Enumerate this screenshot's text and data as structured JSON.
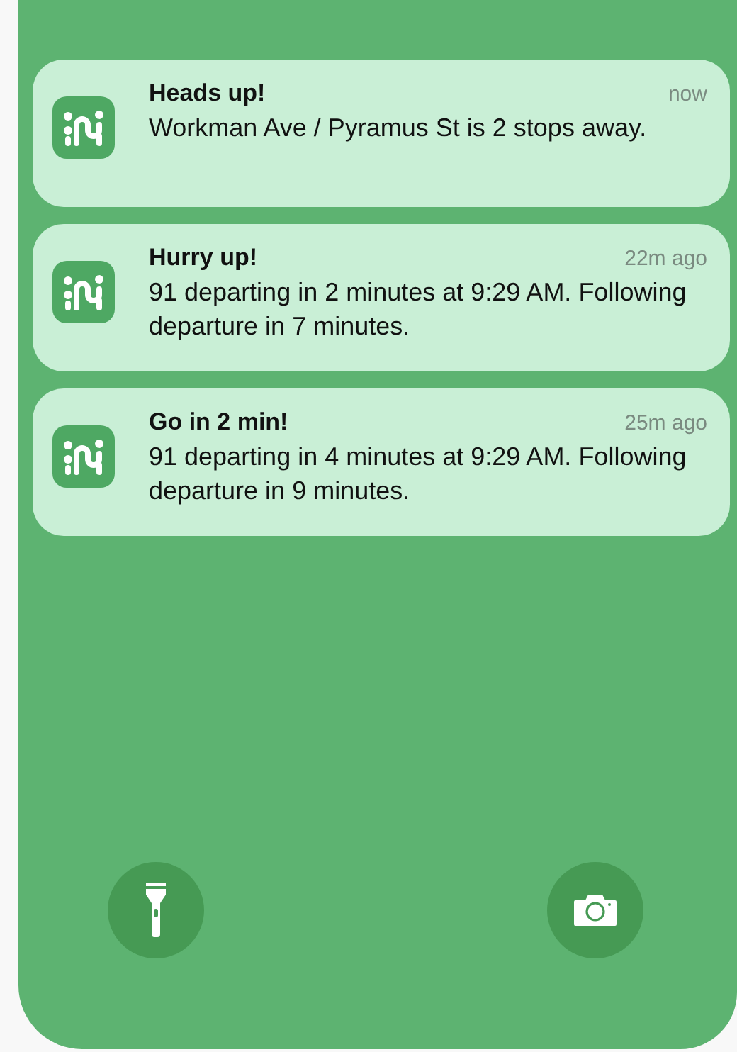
{
  "notifications": [
    {
      "title": "Heads up!",
      "time": "now",
      "body": "Workman Ave / Pyramus St is 2 stops away."
    },
    {
      "title": "Hurry up!",
      "time": "22m ago",
      "body": "91 departing in 2 minutes at 9:29 AM. Following departure in 7 minutes."
    },
    {
      "title": "Go in 2 min!",
      "time": "25m ago",
      "body": "91 departing in 4 minutes at 9:29 AM. Following departure in 9 minutes."
    }
  ],
  "quick_actions": [
    {
      "kind": "flashlight"
    },
    {
      "kind": "camera"
    }
  ]
}
